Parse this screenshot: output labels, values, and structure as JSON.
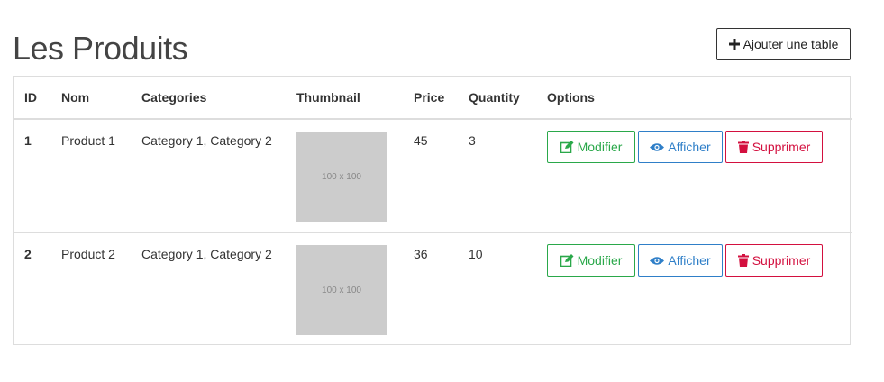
{
  "page": {
    "title": "Les Produits"
  },
  "toolbar": {
    "add_label": "Ajouter une table"
  },
  "table": {
    "headers": [
      "ID",
      "Nom",
      "Categories",
      "Thumbnail",
      "Price",
      "Quantity",
      "Options"
    ],
    "rows": [
      {
        "id": "1",
        "name": "Product 1",
        "categories": "Category 1, Category 2",
        "thumbnail": "100 x 100",
        "price": "45",
        "quantity": "3"
      },
      {
        "id": "2",
        "name": "Product 2",
        "categories": "Category 1, Category 2",
        "thumbnail": "100 x 100",
        "price": "36",
        "quantity": "10"
      }
    ]
  },
  "actions": {
    "edit": "Modifier",
    "view": "Afficher",
    "delete": "Supprimer"
  },
  "icons": {
    "add": "plus-icon",
    "edit": "edit-icon",
    "view": "eye-icon",
    "delete": "trash-icon"
  },
  "colors": {
    "edit": "#2aa84a",
    "view": "#2f7fc8",
    "delete": "#d3103f"
  }
}
